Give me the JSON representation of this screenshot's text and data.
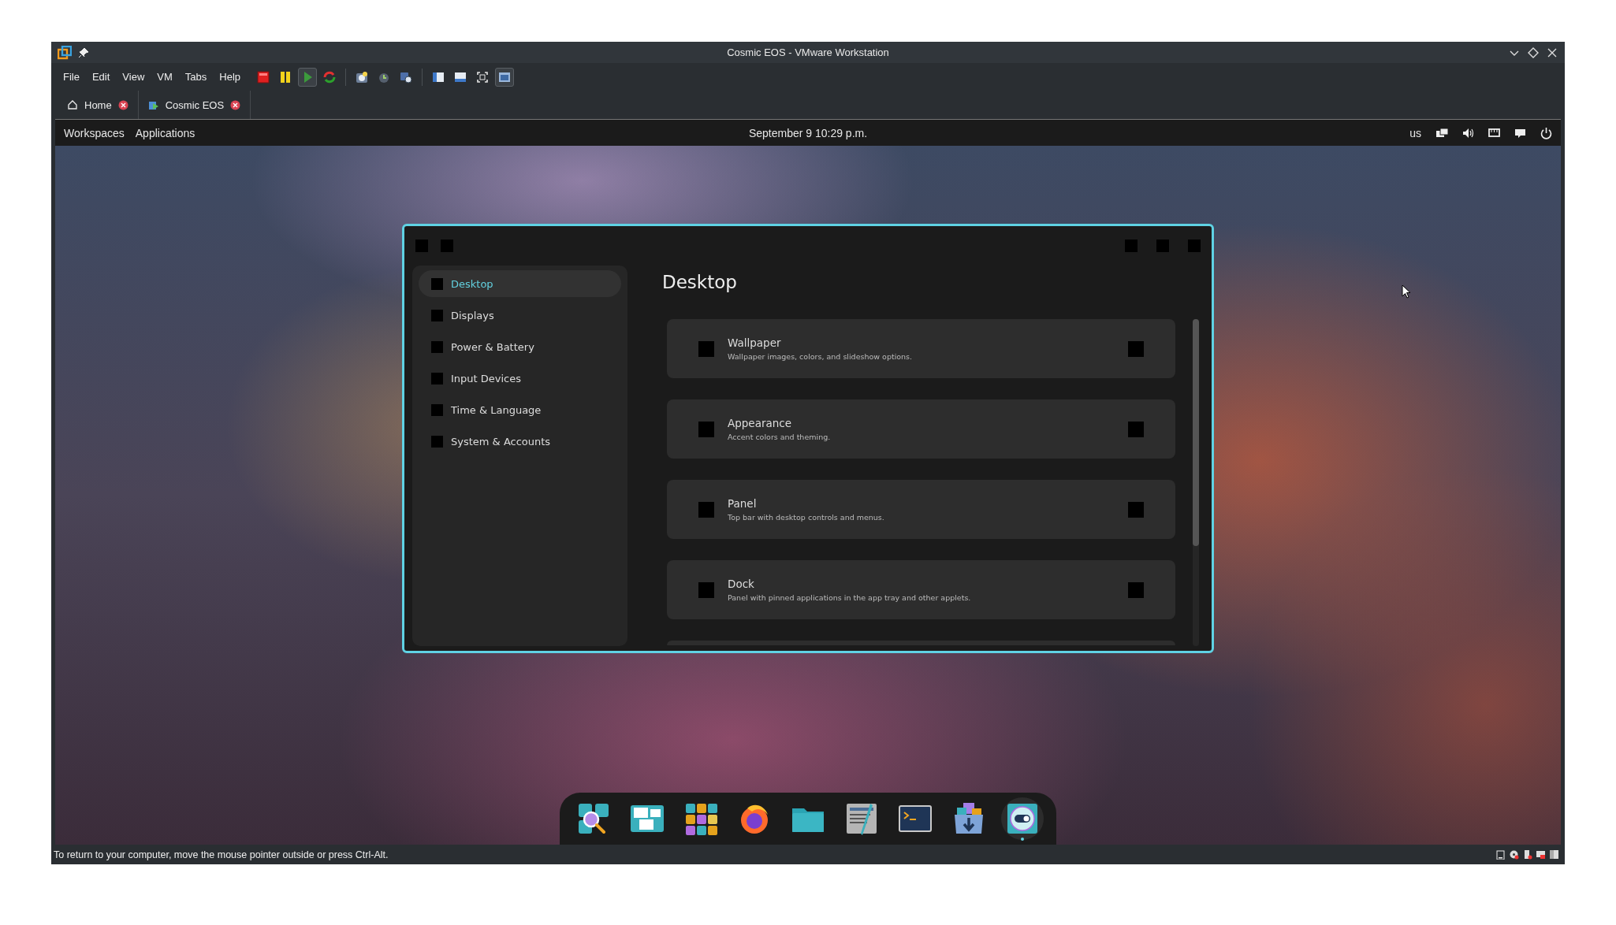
{
  "window": {
    "title": "Cosmic EOS - VMware Workstation"
  },
  "menu": [
    "File",
    "Edit",
    "View",
    "VM",
    "Tabs",
    "Help"
  ],
  "toolbar": [
    {
      "kind": "stop",
      "pressed": false
    },
    {
      "kind": "pause",
      "pressed": false
    },
    {
      "kind": "play",
      "pressed": true
    },
    {
      "kind": "restart",
      "pressed": false
    },
    {
      "kind": "snapshot",
      "pressed": false
    },
    {
      "kind": "revert",
      "pressed": false
    },
    {
      "kind": "manage",
      "pressed": false
    },
    {
      "kind": "sidebar",
      "pressed": false
    },
    {
      "kind": "thumbnails",
      "pressed": false
    },
    {
      "kind": "fullscreen",
      "pressed": false
    },
    {
      "kind": "console",
      "pressed": true
    }
  ],
  "tabs": [
    {
      "label": "Home",
      "kind": "home"
    },
    {
      "label": "Cosmic EOS",
      "kind": "vm"
    }
  ],
  "guest_panel": {
    "left": [
      "Workspaces",
      "Applications"
    ],
    "clock": "September 9 10:29 p.m.",
    "keyboard_layout": "us"
  },
  "settings": {
    "sidebar": [
      {
        "label": "Desktop",
        "selected": true
      },
      {
        "label": "Displays",
        "selected": false
      },
      {
        "label": "Power & Battery",
        "selected": false
      },
      {
        "label": "Input Devices",
        "selected": false
      },
      {
        "label": "Time & Language",
        "selected": false
      },
      {
        "label": "System & Accounts",
        "selected": false
      }
    ],
    "heading": "Desktop",
    "pages": [
      {
        "title": "Wallpaper",
        "description": "Wallpaper images, colors, and slideshow options."
      },
      {
        "title": "Appearance",
        "description": "Accent colors and theming."
      },
      {
        "title": "Panel",
        "description": "Top bar with desktop controls and menus."
      },
      {
        "title": "Dock",
        "description": "Panel with pinned applications in the app tray and other applets."
      }
    ]
  },
  "dock": [
    {
      "kind": "search",
      "active": false
    },
    {
      "kind": "workspaces",
      "active": false
    },
    {
      "kind": "apps",
      "active": false
    },
    {
      "kind": "browser",
      "active": false
    },
    {
      "kind": "files",
      "active": false
    },
    {
      "kind": "editor",
      "active": false
    },
    {
      "kind": "terminal",
      "active": false
    },
    {
      "kind": "store",
      "active": false
    },
    {
      "kind": "settings",
      "active": true
    }
  ],
  "status_bar": {
    "message": "To return to your computer, move the mouse pointer outside or press Ctrl-Alt."
  }
}
